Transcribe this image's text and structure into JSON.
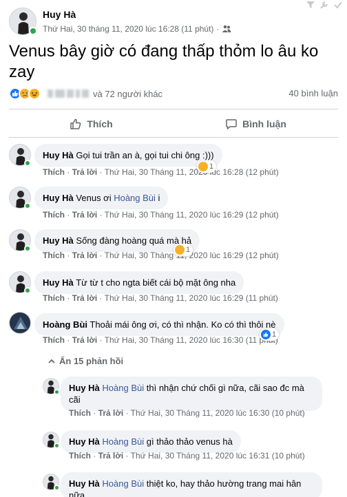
{
  "post": {
    "author": "Huy Hà",
    "timestamp": "Thứ Hai, 30 tháng 11, 2020 lúc 16:28 (11 phút)",
    "separator": "·",
    "audience_icon": "friends-icon",
    "text": "Venus bây giờ có đang thấp thỏm lo âu ko zay"
  },
  "reactions": {
    "others": "và 72 người khác",
    "comment_count": "40 bình luận",
    "icons": [
      "like-icon",
      "sad-icon",
      "haha-icon"
    ]
  },
  "actions": {
    "like": "Thích",
    "comment": "Bình luận"
  },
  "comments": [
    {
      "name": "Huy Hà",
      "tag": "",
      "text": "Gọi tui trần an à, gọi tui chi ông :)))",
      "like": "Thích",
      "reply": "Trả lời",
      "time": "Thứ Hai, 30 Tháng 11, 2020 lúc 16:28 (12 phút)",
      "reaction_count": "1"
    },
    {
      "name": "Huy Hà",
      "tag": "Hoàng Bùi",
      "text": "Venus ơi  ",
      "suffix": "i",
      "like": "Thích",
      "reply": "Trả lời",
      "time": "Thứ Hai, 30 Tháng 11, 2020 lúc 16:29 (12 phút)",
      "reaction_count": ""
    },
    {
      "name": "Huy Hà",
      "tag": "",
      "text": "Sống đàng hoàng quá mà hả",
      "like": "Thích",
      "reply": "Trả lời",
      "time": "Thứ Hai, 30 Tháng 11, 2020 lúc 16:29 (12 phút)",
      "reaction_count": "1"
    },
    {
      "name": "Huy Hà",
      "tag": "",
      "text": "Từ từ t cho ngta biết cái bộ mặt ông nha",
      "like": "Thích",
      "reply": "Trả lời",
      "time": "Thứ Hai, 30 Tháng 11, 2020 lúc 16:29 (11 phút)",
      "reaction_count": ""
    },
    {
      "name": "Hoàng Bùi",
      "tag": "",
      "text": "Thoải mái ông ơi, có thì nhận. Ko có thì thôi nè",
      "like": "Thích",
      "reply": "Trả lời",
      "time": "Thứ Hai, 30 Tháng 11, 2020 lúc 16:30 (11 phút)",
      "reaction_count": "1"
    }
  ],
  "hide_replies": "Ẩn 15 phản hồi",
  "replies": [
    {
      "name": "Huy Hà",
      "tag": "Hoàng Bùi",
      "text": "thì nhận chứ chối gì nữa, cãi sao đc mà cãi",
      "like": "Thích",
      "reply": "Trả lời",
      "time": "Thứ Hai, 30 Tháng 11, 2020 lúc 16:30 (10 phút)"
    },
    {
      "name": "Huy Hà",
      "tag": "Hoàng Bùi",
      "text": "gì thảo thảo venus hà",
      "like": "Thích",
      "reply": "Trả lời",
      "time": "Thứ Hai, 30 Tháng 11, 2020 lúc 16:31 (10 phút)"
    },
    {
      "name": "Huy Hà",
      "tag": "Hoàng Bùi",
      "text": "thiệt ko, hay thảo hường trang mai hân nữa",
      "like": "",
      "reply": "",
      "time": ""
    }
  ],
  "colors": {
    "accent": "#1877f2",
    "online": "#31a24c",
    "tag": "#385898",
    "muted": "#65676b"
  }
}
